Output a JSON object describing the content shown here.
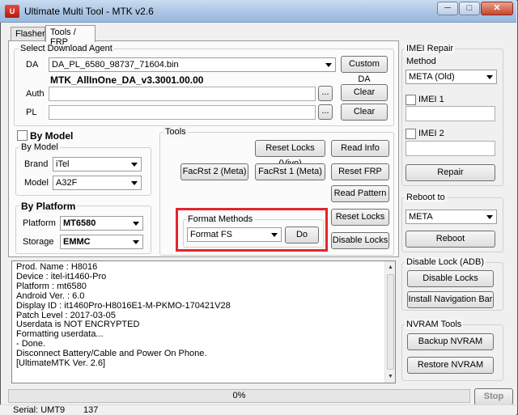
{
  "window": {
    "title": "Ultimate Multi Tool - MTK v2.6",
    "icon_label": "U"
  },
  "caption": {
    "minimize": "─",
    "maximize": "□",
    "close": "✕"
  },
  "tabs": [
    "Flasher",
    "Tools / FRP"
  ],
  "download_agent": {
    "group_label": "Select Download Agent",
    "da_label": "DA",
    "da_value": "DA_PL_6580_98737_71604.bin",
    "custom_da_label": "Custom DA",
    "da_version": "MTK_AllInOne_DA_v3.3001.00.00",
    "auth_label": "Auth",
    "auth_value": "",
    "pl_label": "PL",
    "pl_value": "",
    "browse_label": "...",
    "clear_label": "Clear"
  },
  "by_model": {
    "checkbox_label": "By Model",
    "group_label": "By Model",
    "brand_label": "Brand",
    "brand_value": "iTel",
    "model_label": "Model",
    "model_value": "A32F"
  },
  "by_platform": {
    "group_label": "By Platform",
    "platform_label": "Platform",
    "platform_value": "MT6580",
    "storage_label": "Storage",
    "storage_value": "EMMC"
  },
  "tools": {
    "group_label": "Tools",
    "reset_locks_vivo": "Reset Locks (Vivo)",
    "read_info": "Read Info",
    "facrst2": "FacRst 2 (Meta)",
    "facrst1": "FacRst 1 (Meta)",
    "reset_frp": "Reset FRP",
    "read_pattern": "Read Pattern",
    "reset_locks": "Reset Locks",
    "disable_locks": "Disable Locks",
    "format_group_label": "Format Methods",
    "format_value": "Format FS",
    "do_label": "Do"
  },
  "imei_repair": {
    "group_label": "IMEI Repair",
    "method_label": "Method",
    "method_value": "META (Old)",
    "imei1_label": "IMEI 1",
    "imei1_value": "",
    "imei2_label": "IMEI 2",
    "imei2_value": "",
    "repair_label": "Repair"
  },
  "reboot": {
    "group_label": "Reboot to",
    "mode_value": "META",
    "reboot_label": "Reboot"
  },
  "disable_lock_adb": {
    "group_label": "Disable Lock (ADB)",
    "disable_locks_label": "Disable Locks",
    "install_nav_bar_label": "Install Navigation Bar"
  },
  "nvram": {
    "group_label": "NVRAM Tools",
    "backup_label": "Backup NVRAM",
    "restore_label": "Restore NVRAM"
  },
  "log_lines": [
    "Prod. Name : H8016",
    "Device : itel-it1460-Pro",
    "Platform : mt6580",
    "Android Ver. : 6.0",
    "Display ID : it1460Pro-H8016E1-M-PKMO-170421V28",
    "Patch Level : 2017-03-05",
    "Userdata is NOT ENCRYPTED",
    "Formatting userdata...",
    "- Done.",
    "Disconnect Battery/Cable and Power On Phone.",
    "[UltimateMTK Ver. 2.6]"
  ],
  "progress": {
    "text": "0%",
    "value": 0,
    "stop_label": "Stop"
  },
  "status": {
    "serial_label": "Serial: UMT9",
    "serial_suffix": "137"
  },
  "colors": {
    "highlight_border": "#e2262b"
  }
}
